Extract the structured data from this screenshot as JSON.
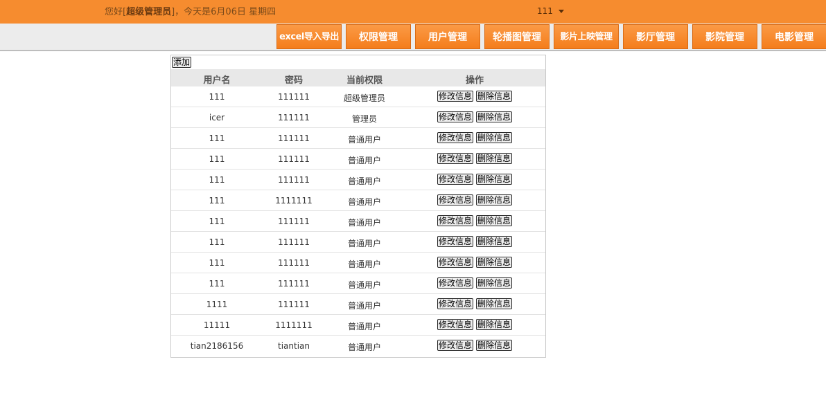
{
  "header": {
    "greeting_prefix": "您好[",
    "user_role": "超级管理员",
    "greeting_suffix": "]，今天是6月06日 星期四",
    "current_user": "111"
  },
  "nav": {
    "items": [
      {
        "label": "excel导入导出"
      },
      {
        "label": "权限管理"
      },
      {
        "label": "用户管理"
      },
      {
        "label": "轮播图管理"
      },
      {
        "label": "影片上映管理"
      },
      {
        "label": "影厅管理"
      },
      {
        "label": "影院管理"
      },
      {
        "label": "电影管理"
      }
    ]
  },
  "table": {
    "add_label": "添加",
    "columns": [
      "用户名",
      "密码",
      "当前权限",
      "操作"
    ],
    "edit_label": "修改信息",
    "delete_label": "删除信息",
    "rows": [
      {
        "username": "111",
        "password": "111111",
        "role": "超级管理员"
      },
      {
        "username": "icer",
        "password": "111111",
        "role": "管理员"
      },
      {
        "username": "111",
        "password": "111111",
        "role": "普通用户"
      },
      {
        "username": "111",
        "password": "111111",
        "role": "普通用户"
      },
      {
        "username": "111",
        "password": "111111",
        "role": "普通用户"
      },
      {
        "username": "111",
        "password": "1111111",
        "role": "普通用户"
      },
      {
        "username": "111",
        "password": "111111",
        "role": "普通用户"
      },
      {
        "username": "111",
        "password": "111111",
        "role": "普通用户"
      },
      {
        "username": "111",
        "password": "111111",
        "role": "普通用户"
      },
      {
        "username": "111",
        "password": "111111",
        "role": "普通用户"
      },
      {
        "username": "1111",
        "password": "111111",
        "role": "普通用户"
      },
      {
        "username": "11111",
        "password": "1111111",
        "role": "普通用户"
      },
      {
        "username": "tian2186156",
        "password": "tiantian",
        "role": "普通用户"
      }
    ]
  },
  "colors": {
    "accent": "#f68c2f",
    "nav_bg": "#ececec",
    "header_row_bg": "#e8e8e8"
  }
}
